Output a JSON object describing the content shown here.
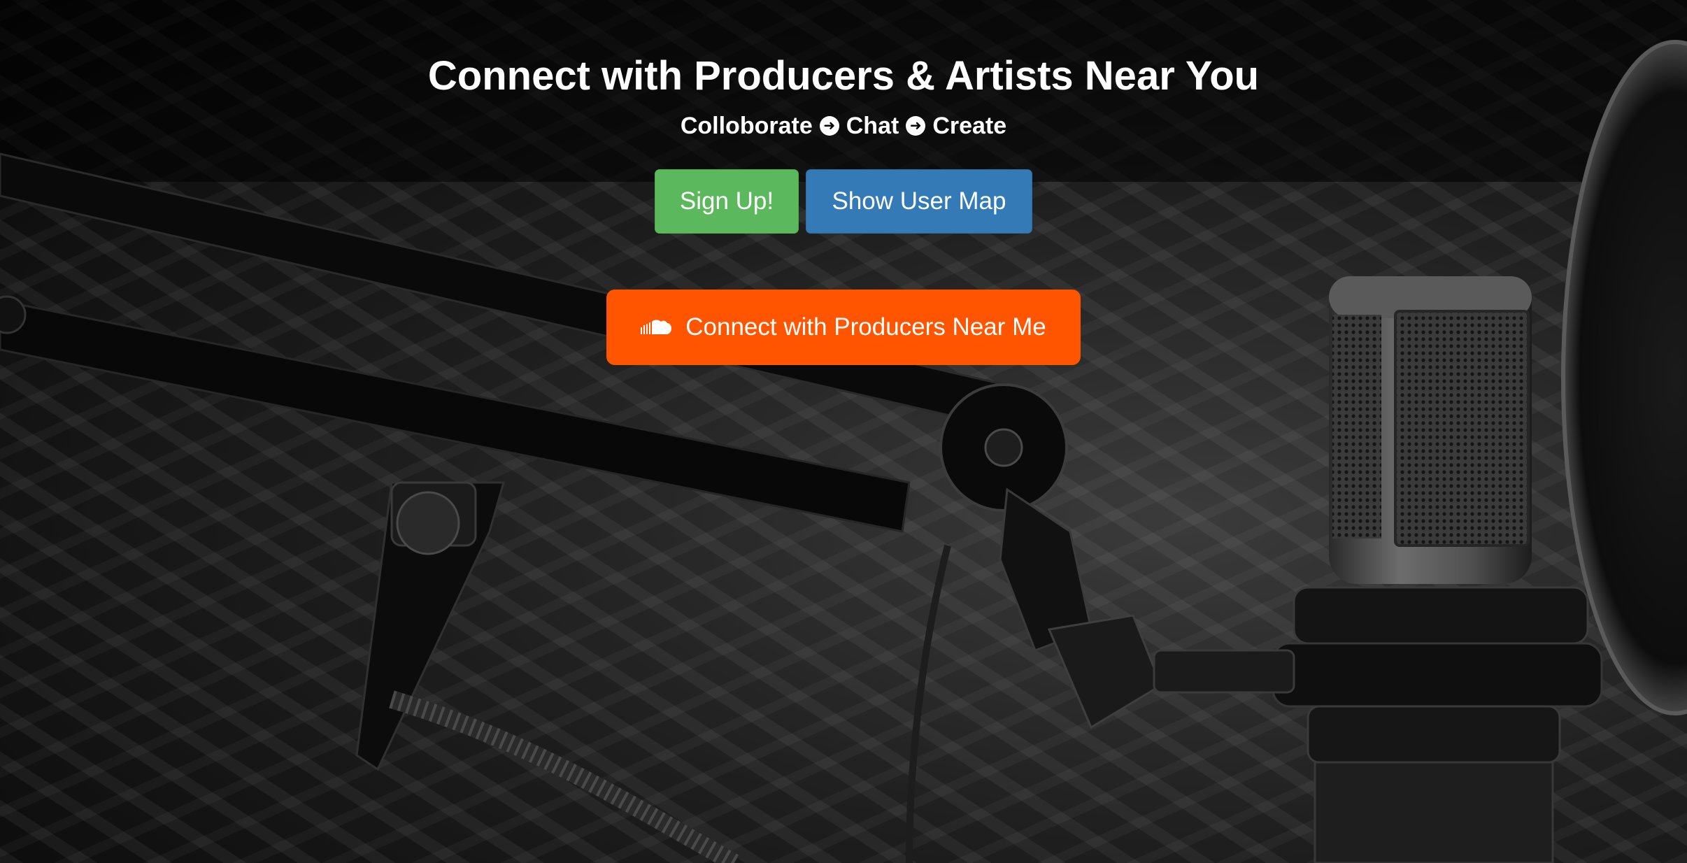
{
  "hero": {
    "headline": "Connect with Producers & Artists Near You",
    "tagline": {
      "step1": "Colloborate",
      "step2": "Chat",
      "step3": "Create",
      "separator_icon": "circle-arrow-right-icon"
    },
    "buttons": {
      "signup_label": "Sign Up!",
      "map_label": "Show User Map",
      "soundcloud_label": "Connect with Producers Near Me",
      "soundcloud_icon": "soundcloud-icon"
    },
    "background_image": "microphone-studio-photo"
  },
  "colors": {
    "signup_green": "#5cb85c",
    "map_blue": "#337ab7",
    "soundcloud_orange": "#ff5500",
    "text_white": "#ffffff"
  }
}
